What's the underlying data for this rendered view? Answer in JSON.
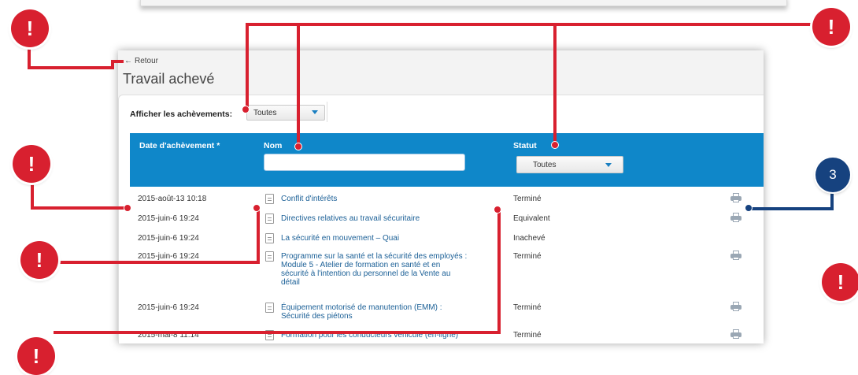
{
  "header": {
    "back_label": "Retour",
    "back_arrow": "←",
    "title": "Travail achevé"
  },
  "filter": {
    "label": "Afficher les achèvements:",
    "selected": "Toutes"
  },
  "table": {
    "columns": {
      "date": "Date d'achèvement *",
      "name": "Nom",
      "status": "Statut"
    },
    "name_filter_value": "",
    "status_filter_selected": "Toutes",
    "rows": [
      {
        "date": "2015-août-13 10:18",
        "title": "Conflit d'intérêts",
        "status": "Terminé",
        "printable": true
      },
      {
        "date": "2015-juin-6 19:24",
        "title": "Directives relatives au travail sécuritaire",
        "status": "Equivalent",
        "printable": true
      },
      {
        "date": "2015-juin-6 19:24",
        "title": "La sécurité en mouvement – Quai",
        "status": "Inachevé",
        "printable": false
      },
      {
        "date": "2015-juin-6 19:24",
        "title": "Programme sur la santé et la sécurité des employés : Module 5 - Atelier de formation en santé et en sécurité à l'intention du personnel de la Vente au détail",
        "status": "Terminé",
        "printable": true
      },
      {
        "date": "2015-juin-6 19:24",
        "title": "Équipement motorisé de manutention (EMM) : Sécurité des piétons",
        "status": "Terminé",
        "printable": true
      },
      {
        "date": "2015-mai-8 11:14",
        "title": "Formation pour les conducteurs véhicule (en-ligne)",
        "status": "Terminé",
        "printable": true
      }
    ]
  },
  "annotations": {
    "alert_symbol": "!",
    "numbered_badge": "3",
    "alert_color": "#d8202f",
    "numbered_color": "#16427f"
  },
  "colors": {
    "table_header": "#0f87c9",
    "link": "#1a5f96"
  }
}
